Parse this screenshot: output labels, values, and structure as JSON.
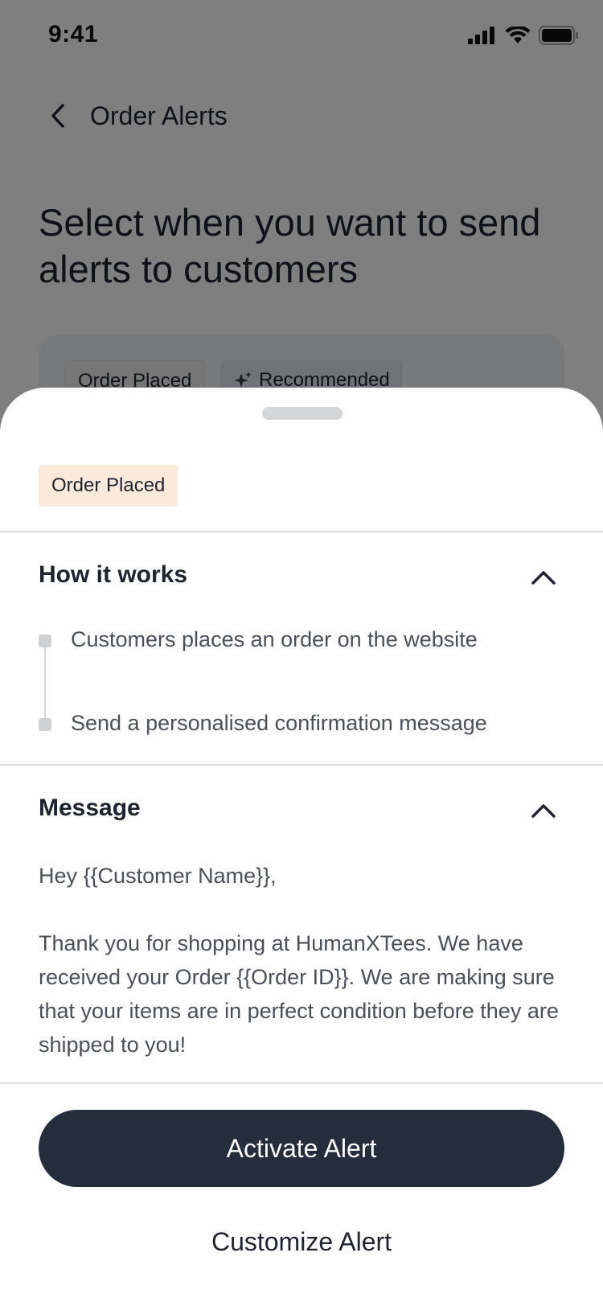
{
  "status_bar": {
    "time": "9:41"
  },
  "header": {
    "title": "Order Alerts",
    "back_icon": "chevron-left-icon"
  },
  "page": {
    "heading": "Select when you want to send alerts to customers"
  },
  "background_card": {
    "chips": [
      "Order Placed",
      "Recommended"
    ],
    "recommended_icon": "sparkle-icon"
  },
  "sheet": {
    "event_label": "Order Placed",
    "how_it_works": {
      "title": "How it works",
      "expanded": true,
      "steps": [
        "Customers places an order on the website",
        "Send a personalised confirmation message"
      ]
    },
    "message": {
      "title": "Message",
      "expanded": true,
      "greeting": "Hey {{Customer Name}},",
      "body": "Thank you for shopping at HumanXTees. We have received your Order {{Order ID}}. We are making sure that your items are in perfect condition before they are shipped to you!"
    },
    "actions": {
      "primary": "Activate Alert",
      "secondary": "Customize Alert"
    }
  },
  "colors": {
    "primary_button": "#252d3c",
    "event_chip_bg": "#fbeadb",
    "scrim": "rgba(0,0,0,0.5)"
  }
}
